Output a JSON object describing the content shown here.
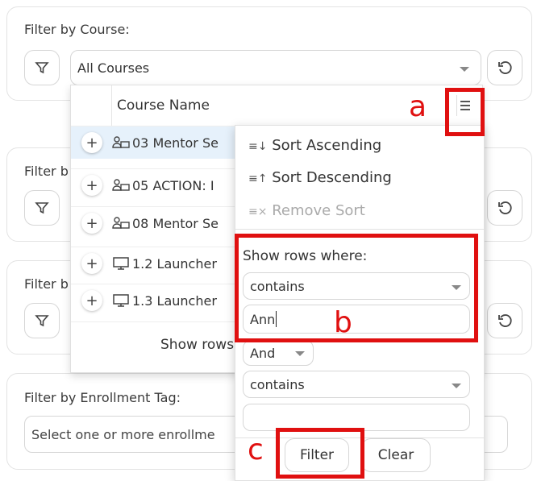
{
  "filter_course": {
    "label": "Filter by Course:",
    "selected": "All Courses"
  },
  "filter_2": {
    "label": "Filter b"
  },
  "filter_3": {
    "label": "Filter b"
  },
  "filter_tag": {
    "label": "Filter by Enrollment Tag:",
    "placeholder": "Select one or more enrollme"
  },
  "grid": {
    "header": "Course Name",
    "rows": [
      {
        "text": "03 Mentor Se",
        "icon": "group-icon"
      },
      {
        "text": "05 ACTION: I",
        "icon": "group-icon"
      },
      {
        "text": "08 Mentor Se",
        "icon": "group-icon"
      },
      {
        "text": "1.2 Launcher",
        "icon": "monitor-icon"
      },
      {
        "text": "1.3 Launcher",
        "icon": "monitor-icon"
      }
    ],
    "footer": "Show rows"
  },
  "menu": {
    "sort_asc": "Sort Ascending",
    "sort_desc": "Sort Descending",
    "remove_sort": "Remove Sort",
    "show_rows_where": "Show rows where:",
    "op1": "contains",
    "value1": "Ann",
    "logic": "And",
    "op2": "contains",
    "value2": "",
    "filter_btn": "Filter",
    "clear_btn": "Clear"
  },
  "annotations": {
    "a": "a",
    "b": "b",
    "c": "c"
  },
  "colors": {
    "highlight_row": "#e6f1fb",
    "annotation": "#e01010"
  }
}
